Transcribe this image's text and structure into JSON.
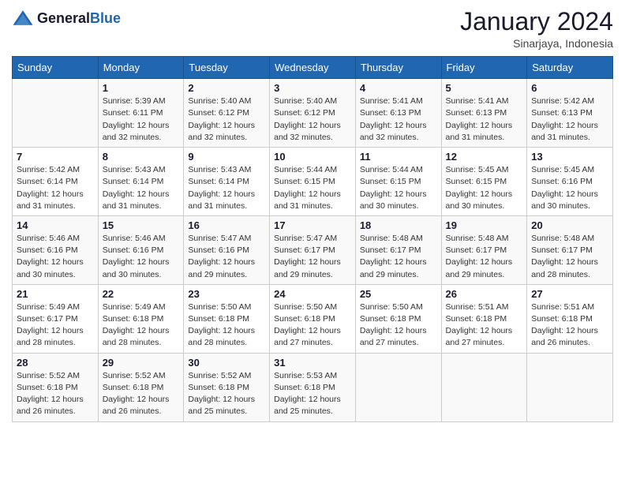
{
  "logo": {
    "text_general": "General",
    "text_blue": "Blue"
  },
  "title": "January 2024",
  "subtitle": "Sinarjaya, Indonesia",
  "days_of_week": [
    "Sunday",
    "Monday",
    "Tuesday",
    "Wednesday",
    "Thursday",
    "Friday",
    "Saturday"
  ],
  "weeks": [
    [
      {
        "day": "",
        "detail": ""
      },
      {
        "day": "1",
        "detail": "Sunrise: 5:39 AM\nSunset: 6:11 PM\nDaylight: 12 hours and 32 minutes."
      },
      {
        "day": "2",
        "detail": "Sunrise: 5:40 AM\nSunset: 6:12 PM\nDaylight: 12 hours and 32 minutes."
      },
      {
        "day": "3",
        "detail": "Sunrise: 5:40 AM\nSunset: 6:12 PM\nDaylight: 12 hours and 32 minutes."
      },
      {
        "day": "4",
        "detail": "Sunrise: 5:41 AM\nSunset: 6:13 PM\nDaylight: 12 hours and 32 minutes."
      },
      {
        "day": "5",
        "detail": "Sunrise: 5:41 AM\nSunset: 6:13 PM\nDaylight: 12 hours and 31 minutes."
      },
      {
        "day": "6",
        "detail": "Sunrise: 5:42 AM\nSunset: 6:13 PM\nDaylight: 12 hours and 31 minutes."
      }
    ],
    [
      {
        "day": "7",
        "detail": "Sunrise: 5:42 AM\nSunset: 6:14 PM\nDaylight: 12 hours and 31 minutes."
      },
      {
        "day": "8",
        "detail": "Sunrise: 5:43 AM\nSunset: 6:14 PM\nDaylight: 12 hours and 31 minutes."
      },
      {
        "day": "9",
        "detail": "Sunrise: 5:43 AM\nSunset: 6:14 PM\nDaylight: 12 hours and 31 minutes."
      },
      {
        "day": "10",
        "detail": "Sunrise: 5:44 AM\nSunset: 6:15 PM\nDaylight: 12 hours and 31 minutes."
      },
      {
        "day": "11",
        "detail": "Sunrise: 5:44 AM\nSunset: 6:15 PM\nDaylight: 12 hours and 30 minutes."
      },
      {
        "day": "12",
        "detail": "Sunrise: 5:45 AM\nSunset: 6:15 PM\nDaylight: 12 hours and 30 minutes."
      },
      {
        "day": "13",
        "detail": "Sunrise: 5:45 AM\nSunset: 6:16 PM\nDaylight: 12 hours and 30 minutes."
      }
    ],
    [
      {
        "day": "14",
        "detail": "Sunrise: 5:46 AM\nSunset: 6:16 PM\nDaylight: 12 hours and 30 minutes."
      },
      {
        "day": "15",
        "detail": "Sunrise: 5:46 AM\nSunset: 6:16 PM\nDaylight: 12 hours and 30 minutes."
      },
      {
        "day": "16",
        "detail": "Sunrise: 5:47 AM\nSunset: 6:16 PM\nDaylight: 12 hours and 29 minutes."
      },
      {
        "day": "17",
        "detail": "Sunrise: 5:47 AM\nSunset: 6:17 PM\nDaylight: 12 hours and 29 minutes."
      },
      {
        "day": "18",
        "detail": "Sunrise: 5:48 AM\nSunset: 6:17 PM\nDaylight: 12 hours and 29 minutes."
      },
      {
        "day": "19",
        "detail": "Sunrise: 5:48 AM\nSunset: 6:17 PM\nDaylight: 12 hours and 29 minutes."
      },
      {
        "day": "20",
        "detail": "Sunrise: 5:48 AM\nSunset: 6:17 PM\nDaylight: 12 hours and 28 minutes."
      }
    ],
    [
      {
        "day": "21",
        "detail": "Sunrise: 5:49 AM\nSunset: 6:17 PM\nDaylight: 12 hours and 28 minutes."
      },
      {
        "day": "22",
        "detail": "Sunrise: 5:49 AM\nSunset: 6:18 PM\nDaylight: 12 hours and 28 minutes."
      },
      {
        "day": "23",
        "detail": "Sunrise: 5:50 AM\nSunset: 6:18 PM\nDaylight: 12 hours and 28 minutes."
      },
      {
        "day": "24",
        "detail": "Sunrise: 5:50 AM\nSunset: 6:18 PM\nDaylight: 12 hours and 27 minutes."
      },
      {
        "day": "25",
        "detail": "Sunrise: 5:50 AM\nSunset: 6:18 PM\nDaylight: 12 hours and 27 minutes."
      },
      {
        "day": "26",
        "detail": "Sunrise: 5:51 AM\nSunset: 6:18 PM\nDaylight: 12 hours and 27 minutes."
      },
      {
        "day": "27",
        "detail": "Sunrise: 5:51 AM\nSunset: 6:18 PM\nDaylight: 12 hours and 26 minutes."
      }
    ],
    [
      {
        "day": "28",
        "detail": "Sunrise: 5:52 AM\nSunset: 6:18 PM\nDaylight: 12 hours and 26 minutes."
      },
      {
        "day": "29",
        "detail": "Sunrise: 5:52 AM\nSunset: 6:18 PM\nDaylight: 12 hours and 26 minutes."
      },
      {
        "day": "30",
        "detail": "Sunrise: 5:52 AM\nSunset: 6:18 PM\nDaylight: 12 hours and 25 minutes."
      },
      {
        "day": "31",
        "detail": "Sunrise: 5:53 AM\nSunset: 6:18 PM\nDaylight: 12 hours and 25 minutes."
      },
      {
        "day": "",
        "detail": ""
      },
      {
        "day": "",
        "detail": ""
      },
      {
        "day": "",
        "detail": ""
      }
    ]
  ]
}
